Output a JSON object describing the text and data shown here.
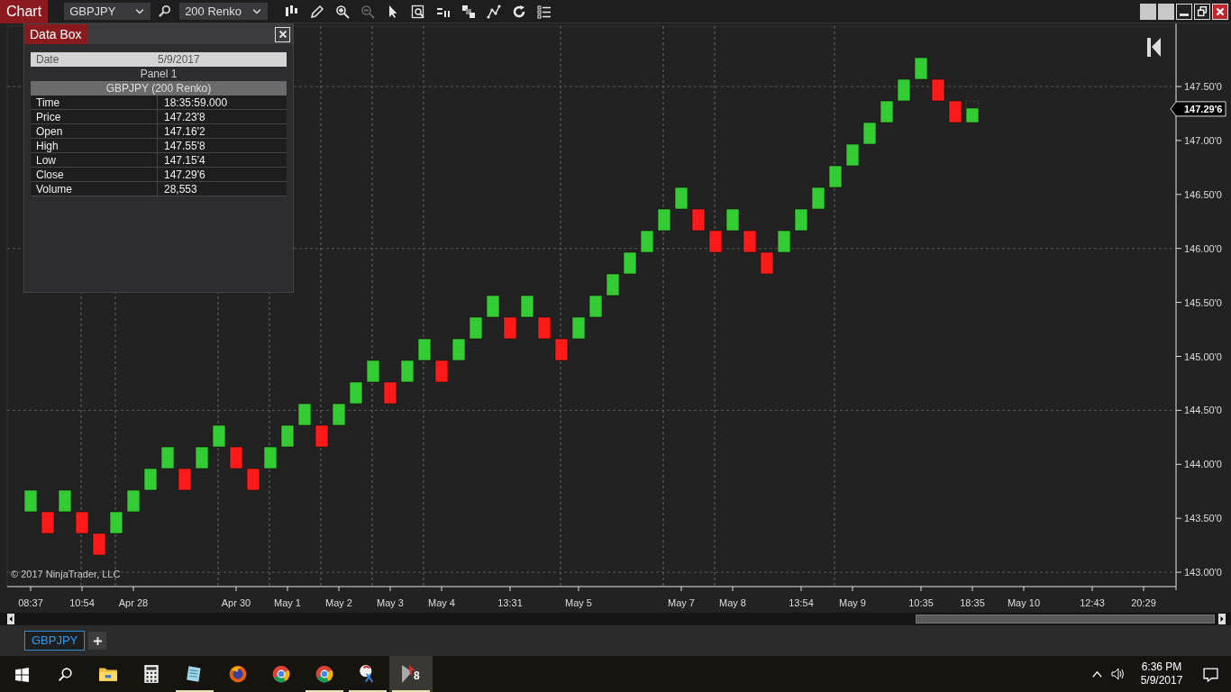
{
  "window": {
    "title": "Chart",
    "buttons": [
      {
        "kind": "blank"
      },
      {
        "kind": "blank"
      },
      {
        "kind": "minimize"
      },
      {
        "kind": "restore"
      },
      {
        "kind": "close"
      }
    ]
  },
  "toolbar": {
    "instrument": "GBPJPY",
    "bar_type": "200 Renko",
    "buttons": [
      {
        "kind": "bars",
        "disabled": false
      },
      {
        "kind": "pencil",
        "disabled": false
      },
      {
        "kind": "zoom-in",
        "disabled": false
      },
      {
        "kind": "zoom-out",
        "disabled": true
      },
      {
        "kind": "pointer",
        "disabled": false
      },
      {
        "kind": "data-box",
        "disabled": false
      },
      {
        "kind": "properties",
        "disabled": false
      },
      {
        "kind": "squares",
        "disabled": false
      },
      {
        "kind": "nodes",
        "disabled": false
      },
      {
        "kind": "reload",
        "disabled": false
      },
      {
        "kind": "list",
        "disabled": false
      }
    ]
  },
  "data_box": {
    "title": "Data Box",
    "date_label": "Date",
    "date_value": "5/9/2017",
    "panel": "Panel 1",
    "series": "GBPJPY (200 Renko)",
    "rows": [
      {
        "label": "Time",
        "value": "18:35:59.000"
      },
      {
        "label": "Price",
        "value": "147.23'8"
      },
      {
        "label": "Open",
        "value": "147.16'2"
      },
      {
        "label": "High",
        "value": "147.55'8"
      },
      {
        "label": "Low",
        "value": "147.15'4"
      },
      {
        "label": "Close",
        "value": "147.29'6"
      },
      {
        "label": "Volume",
        "value": "28,553"
      }
    ]
  },
  "chart": {
    "copyright": "© 2017 NinjaTrader, LLC",
    "current_price": "147.29'6",
    "price_labels": [
      "147.50'0",
      "147.00'0",
      "146.50'0",
      "146.00'0",
      "145.50'0",
      "145.00'0",
      "144.50'0",
      "144.00'0",
      "143.50'0",
      "143.00'0"
    ],
    "time_labels": [
      "08:37",
      "10:54",
      "Apr 28",
      "Apr 30",
      "May 1",
      "May 2",
      "May 3",
      "May 4",
      "13:31",
      "May 5",
      "May 7",
      "May 8",
      "13:54",
      "May 9",
      "10:35",
      "18:35",
      "May 10",
      "12:43",
      "20:29"
    ],
    "bricks": [
      {
        "kind": "up"
      },
      {
        "kind": "down"
      },
      {
        "kind": "up"
      },
      {
        "kind": "down"
      },
      {
        "kind": "down"
      },
      {
        "kind": "up"
      },
      {
        "kind": "up"
      },
      {
        "kind": "up"
      },
      {
        "kind": "up"
      },
      {
        "kind": "down"
      },
      {
        "kind": "up"
      },
      {
        "kind": "up"
      },
      {
        "kind": "down"
      },
      {
        "kind": "down"
      },
      {
        "kind": "up"
      },
      {
        "kind": "up"
      },
      {
        "kind": "up"
      },
      {
        "kind": "down"
      },
      {
        "kind": "up"
      },
      {
        "kind": "up"
      },
      {
        "kind": "up"
      },
      {
        "kind": "down"
      },
      {
        "kind": "up"
      },
      {
        "kind": "up"
      },
      {
        "kind": "down"
      },
      {
        "kind": "up"
      },
      {
        "kind": "up"
      },
      {
        "kind": "up"
      },
      {
        "kind": "down"
      },
      {
        "kind": "up"
      },
      {
        "kind": "down"
      },
      {
        "kind": "down"
      },
      {
        "kind": "up"
      },
      {
        "kind": "up"
      },
      {
        "kind": "up"
      },
      {
        "kind": "up"
      },
      {
        "kind": "up"
      },
      {
        "kind": "up"
      },
      {
        "kind": "up"
      },
      {
        "kind": "down"
      },
      {
        "kind": "down"
      },
      {
        "kind": "up"
      },
      {
        "kind": "down"
      },
      {
        "kind": "down"
      },
      {
        "kind": "up"
      },
      {
        "kind": "up"
      },
      {
        "kind": "up"
      },
      {
        "kind": "up"
      },
      {
        "kind": "up"
      },
      {
        "kind": "up"
      },
      {
        "kind": "up"
      },
      {
        "kind": "up"
      },
      {
        "kind": "up"
      },
      {
        "kind": "down"
      },
      {
        "kind": "down"
      },
      {
        "kind": "up",
        "level": 0.67
      }
    ]
  },
  "tabs": [
    {
      "label": "GBPJPY",
      "selected": true
    }
  ],
  "taskbar": {
    "apps": [
      {
        "kind": "folder",
        "running": false,
        "selected": false
      },
      {
        "kind": "calculator",
        "running": false,
        "selected": false
      },
      {
        "kind": "notepad",
        "running": true,
        "selected": false
      },
      {
        "kind": "firefox",
        "running": false,
        "selected": false
      },
      {
        "kind": "chrome",
        "running": false,
        "selected": false
      },
      {
        "kind": "chrome",
        "running": true,
        "selected": false
      },
      {
        "kind": "scissors",
        "running": true,
        "selected": false
      },
      {
        "kind": "ninja",
        "running": true,
        "selected": true,
        "badge": "8"
      }
    ],
    "time": "6:36 PM",
    "date": "5/9/2017"
  }
}
